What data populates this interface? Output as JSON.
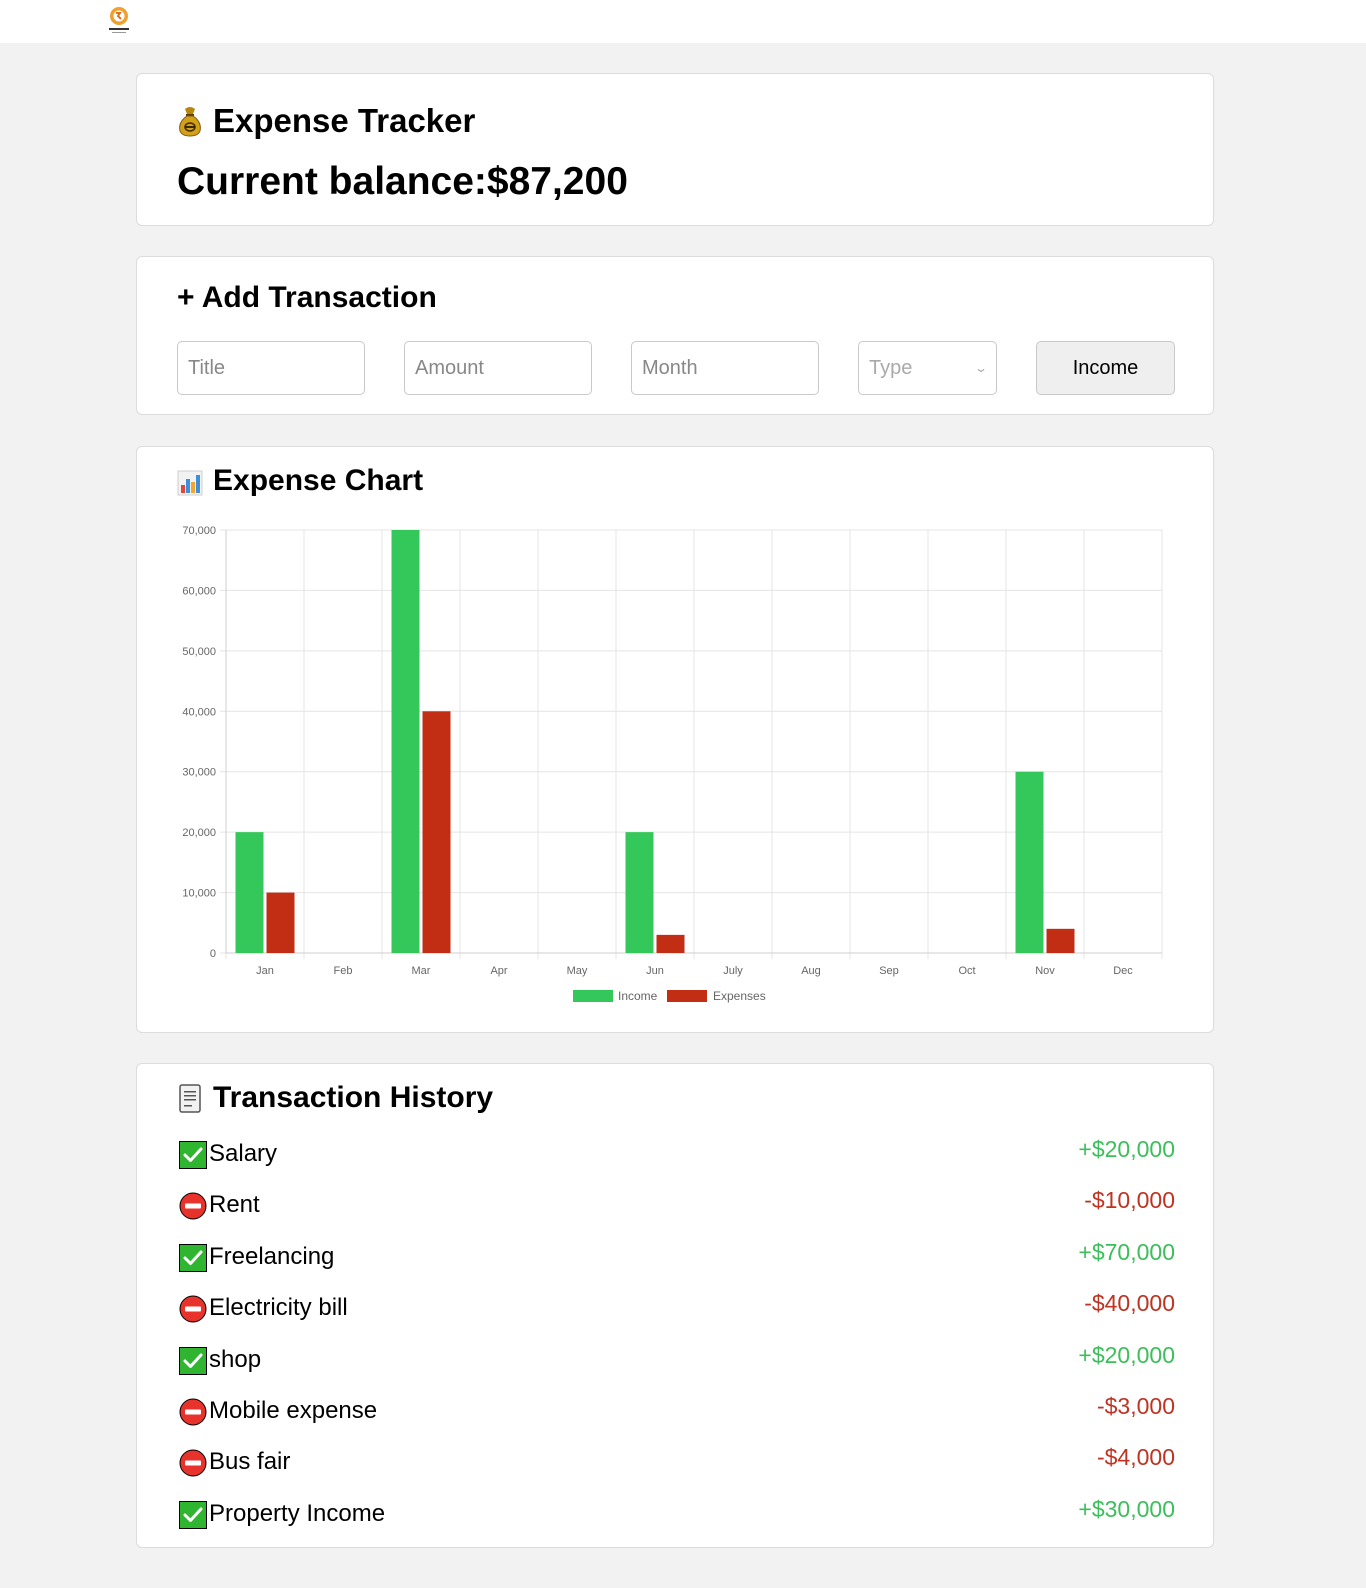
{
  "header": {
    "title": "Expense Tracker",
    "balance_label": "Current balance:",
    "balance_value": "$87,200"
  },
  "add_transaction": {
    "title": "+ Add Transaction",
    "title_placeholder": "Title",
    "amount_placeholder": "Amount",
    "month_placeholder": "Month",
    "type_placeholder": "Type",
    "submit_label": "Income"
  },
  "chart_section": {
    "title": "Expense Chart"
  },
  "chart_data": {
    "type": "bar",
    "categories": [
      "Jan",
      "Feb",
      "Mar",
      "Apr",
      "May",
      "Jun",
      "July",
      "Aug",
      "Sep",
      "Oct",
      "Nov",
      "Dec"
    ],
    "series": [
      {
        "name": "Income",
        "color": "#34c759",
        "values": [
          20000,
          0,
          70000,
          0,
          0,
          20000,
          0,
          0,
          0,
          0,
          30000,
          0
        ]
      },
      {
        "name": "Expenses",
        "color": "#c12e14",
        "values": [
          10000,
          0,
          40000,
          0,
          0,
          3000,
          0,
          0,
          0,
          0,
          4000,
          0
        ]
      }
    ],
    "ylim": [
      0,
      70000
    ],
    "yticks": [
      "0",
      "10,000",
      "20,000",
      "30,000",
      "40,000",
      "50,000",
      "60,000",
      "70,000"
    ],
    "grid": true,
    "legend": "bottom"
  },
  "history": {
    "title": "Transaction History",
    "items": [
      {
        "title": "Salary",
        "amount": "+$20,000",
        "type": "income"
      },
      {
        "title": "Rent",
        "amount": "-$10,000",
        "type": "expense"
      },
      {
        "title": "Freelancing",
        "amount": "+$70,000",
        "type": "income"
      },
      {
        "title": "Electricity bill",
        "amount": "-$40,000",
        "type": "expense"
      },
      {
        "title": "shop",
        "amount": "+$20,000",
        "type": "income"
      },
      {
        "title": "Mobile expense",
        "amount": "-$3,000",
        "type": "expense"
      },
      {
        "title": "Bus fair",
        "amount": "-$4,000",
        "type": "expense"
      },
      {
        "title": "Property Income",
        "amount": "+$30,000",
        "type": "income"
      }
    ]
  },
  "icons": {
    "logo": "expense-logo",
    "title": "money-bag-icon",
    "chart": "bar-chart-icon",
    "history": "ledger-icon",
    "income": "check-mark-icon",
    "expense": "no-entry-icon"
  },
  "colors": {
    "income": "#34c759",
    "expense": "#c12e14",
    "income_text": "#3cbf5a",
    "expense_text": "#bf3322"
  }
}
